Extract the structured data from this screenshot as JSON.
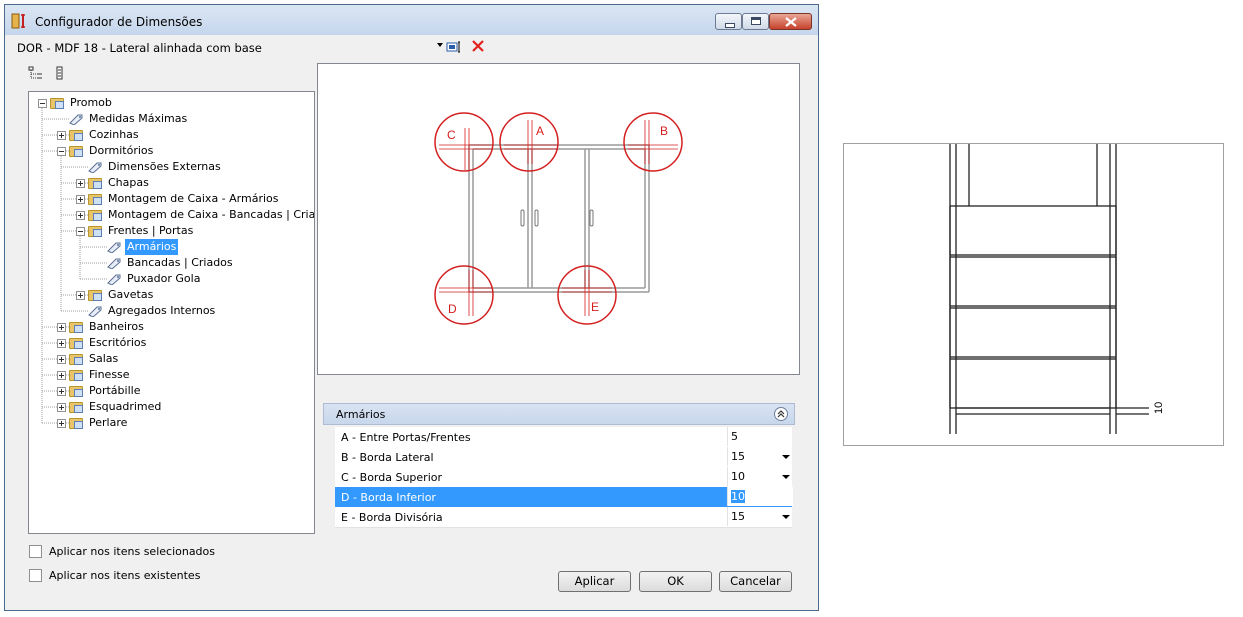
{
  "window": {
    "title": "Configurador de Dimensões",
    "icon": "ruler-app-icon",
    "caption_buttons": [
      "minimize",
      "maximize",
      "close"
    ]
  },
  "toolbar": {
    "combo_value": "DOR - MDF 18 - Lateral alinhada com base",
    "icons": [
      "edit-name-icon",
      "delete-icon"
    ]
  },
  "tree": {
    "toolbar_icons": [
      "expand-tree-icon",
      "collapse-tree-icon"
    ],
    "nodes": [
      {
        "label": "Promob",
        "type": "folder",
        "expander": "minus",
        "level": 0
      },
      {
        "label": "Medidas Máximas",
        "type": "item",
        "level": 1
      },
      {
        "label": "Cozinhas",
        "type": "folder",
        "expander": "plus",
        "level": 1
      },
      {
        "label": "Dormitórios",
        "type": "folder",
        "expander": "minus",
        "level": 1
      },
      {
        "label": "Dimensões Externas",
        "type": "item",
        "level": 2
      },
      {
        "label": "Chapas",
        "type": "folder",
        "expander": "plus",
        "level": 2
      },
      {
        "label": "Montagem de Caixa - Armários",
        "type": "folder",
        "expander": "plus",
        "level": 2
      },
      {
        "label": "Montagem de Caixa - Bancadas | Criados",
        "type": "folder",
        "expander": "plus",
        "level": 2
      },
      {
        "label": "Frentes | Portas",
        "type": "folder",
        "expander": "minus",
        "level": 2
      },
      {
        "label": "Armários",
        "type": "item",
        "level": 3,
        "selected": true
      },
      {
        "label": "Bancadas | Criados",
        "type": "item",
        "level": 3
      },
      {
        "label": "Puxador Gola",
        "type": "item",
        "level": 3
      },
      {
        "label": "Gavetas",
        "type": "folder",
        "expander": "plus",
        "level": 2
      },
      {
        "label": "Agregados Internos",
        "type": "item",
        "level": 2
      },
      {
        "label": "Banheiros",
        "type": "folder",
        "expander": "plus",
        "level": 1
      },
      {
        "label": "Escritórios",
        "type": "folder",
        "expander": "plus",
        "level": 1
      },
      {
        "label": "Salas",
        "type": "folder",
        "expander": "plus",
        "level": 1
      },
      {
        "label": "Finesse",
        "type": "folder",
        "expander": "plus",
        "level": 1
      },
      {
        "label": "Portábille",
        "type": "folder",
        "expander": "plus",
        "level": 1
      },
      {
        "label": "Esquadrimed",
        "type": "folder",
        "expander": "plus",
        "level": 1
      },
      {
        "label": "Perlare",
        "type": "folder",
        "expander": "plus",
        "level": 1
      }
    ]
  },
  "preview": {
    "callouts": [
      "C",
      "A",
      "B",
      "D",
      "E"
    ],
    "accent_color": "#d42020"
  },
  "properties": {
    "group_label": "Armários",
    "rows": [
      {
        "name": "A - Entre Portas/Frentes",
        "value": "5",
        "dropdown": false
      },
      {
        "name": "B - Borda Lateral",
        "value": "15",
        "dropdown": true
      },
      {
        "name": "C - Borda Superior",
        "value": "10",
        "dropdown": true
      },
      {
        "name": "D - Borda Inferior",
        "value": "10",
        "dropdown": false,
        "selected": true
      },
      {
        "name": "E - Borda Divisória",
        "value": "15",
        "dropdown": true
      }
    ]
  },
  "options": {
    "apply_selected": "Aplicar nos itens selecionados",
    "apply_existing": "Aplicar nos itens existentes"
  },
  "buttons": {
    "apply": "Aplicar",
    "ok": "OK",
    "cancel": "Cancelar"
  },
  "side_preview": {
    "dimension_label": "10"
  }
}
